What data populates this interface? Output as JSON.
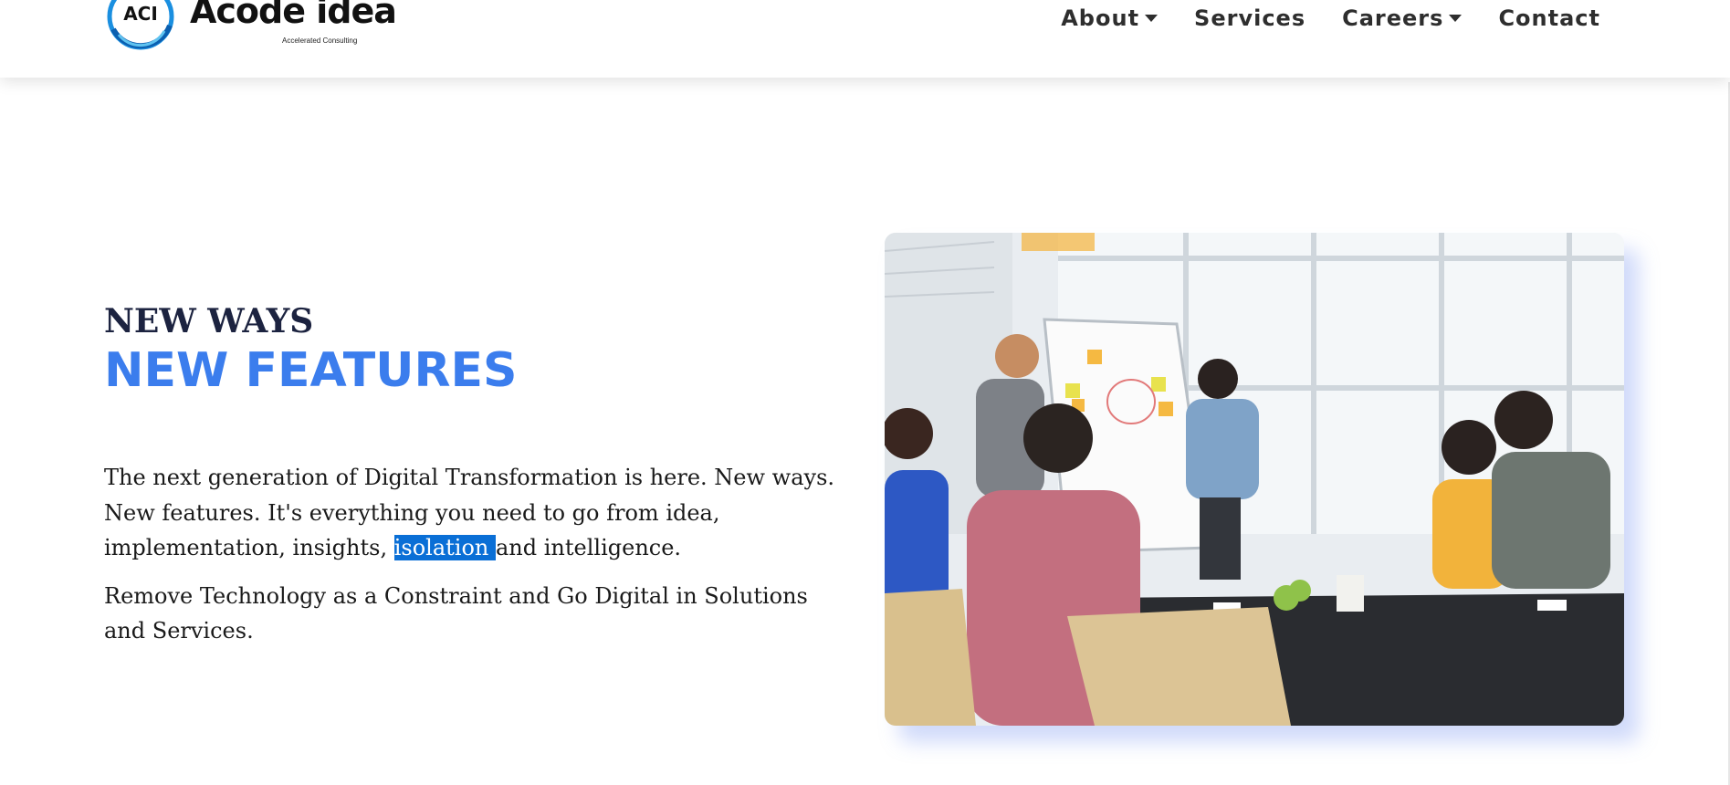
{
  "header": {
    "logo": {
      "mark_text": "ACI",
      "brand_text": "Acode idea",
      "tagline": "Accelerated Consulting"
    },
    "nav": [
      {
        "label": "About",
        "has_dropdown": true
      },
      {
        "label": "Services",
        "has_dropdown": false
      },
      {
        "label": "Careers",
        "has_dropdown": true
      },
      {
        "label": "Contact",
        "has_dropdown": false
      }
    ]
  },
  "hero": {
    "eyebrow": "NEW WAYS",
    "headline": "NEW FEATURES",
    "paragraph1_before": "The next generation of Digital Transformation is here. New ways. New features. It's everything you need to go from idea, implementation, insights, ",
    "paragraph1_selected": "isolation ",
    "paragraph1_after": "and intelligence.",
    "paragraph2": "Remove Technology as a Constraint and Go Digital in Solutions and Services.",
    "image_alt": "team meeting at whiteboard"
  },
  "colors": {
    "accent": "#3b7ded",
    "heading": "#1c2340",
    "selection": "#0a6fd6"
  }
}
